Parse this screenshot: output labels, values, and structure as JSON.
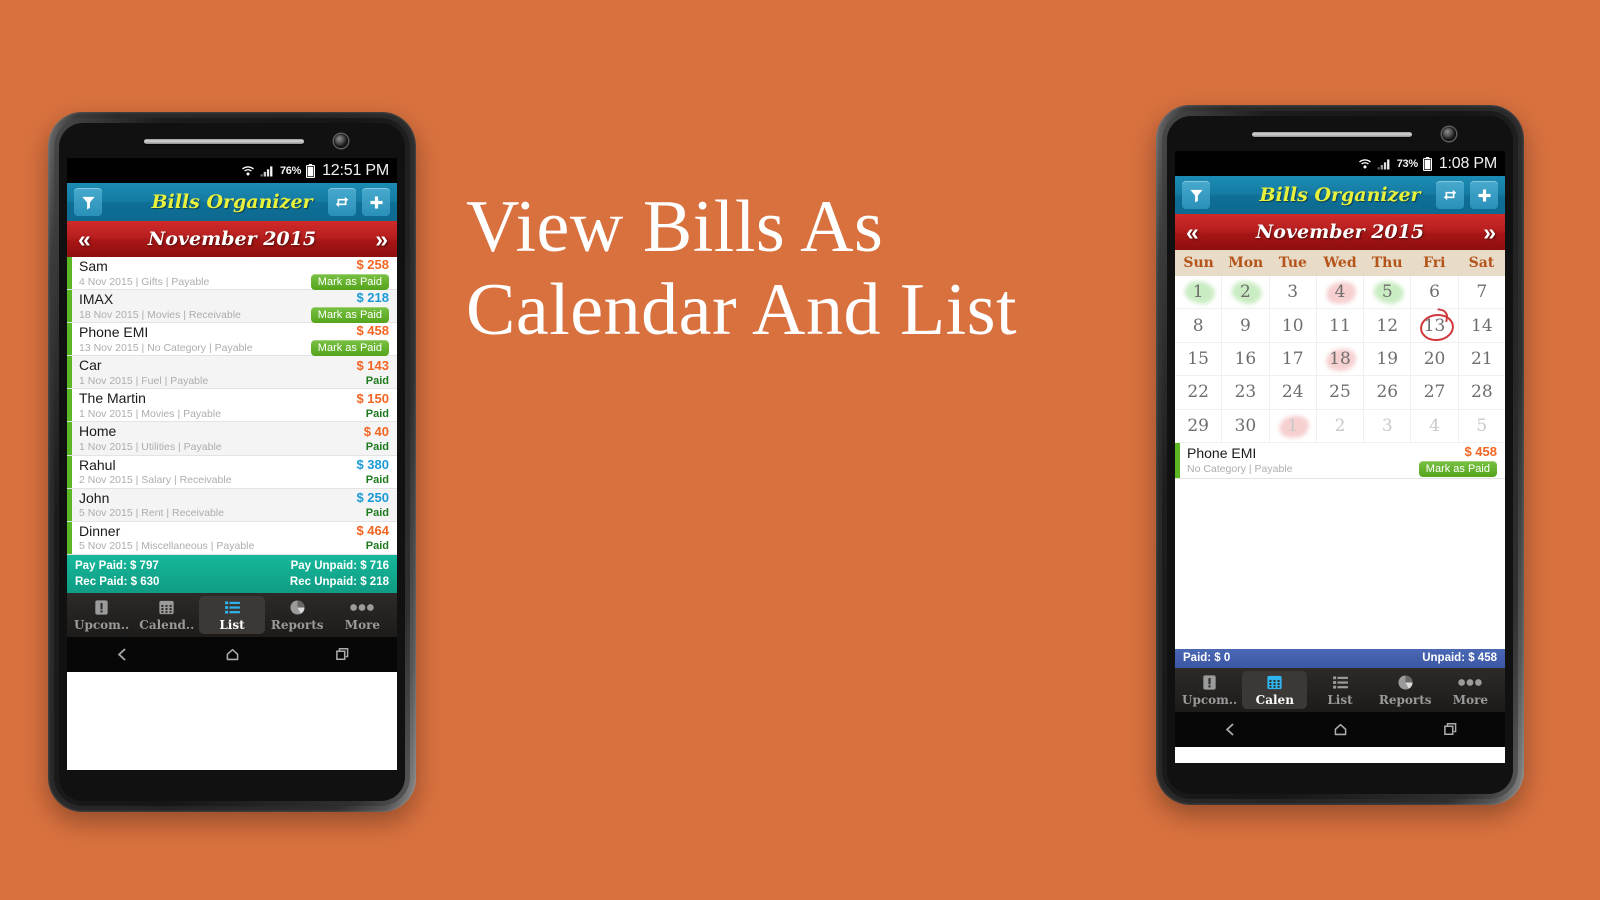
{
  "background_color": "#d9713f",
  "headline": {
    "line1": "View Bills As",
    "line2": "Calendar And List",
    "color": "#ffffff"
  },
  "colors": {
    "appbar": "#0f7ba3",
    "monthbar": "#b81f1f",
    "brand_yellow": "#e8f23c",
    "accent_green": "#5bb723",
    "payable_orange": "#f26522",
    "receivable_blue": "#1b9ad6",
    "summary_teal": "#10a88f",
    "summary_blue": "#4159a8",
    "calendar_header": "#e8dcc8",
    "calendar_dow_text": "#b5541a"
  },
  "phone_left": {
    "status_bar": {
      "wifi_icon": "wifi-icon",
      "signal_icon": "signal-icon",
      "battery_percent": "76%",
      "battery_icon": "battery-icon",
      "time": "12:51 PM"
    },
    "app_bar": {
      "filter_icon": "filter-icon",
      "title": "Bills Organizer",
      "repeat_icon": "repeat-icon",
      "add_icon": "plus-icon"
    },
    "month_bar": {
      "prev_icon": "chevron-double-left-icon",
      "title": "November 2015",
      "next_icon": "chevron-double-right-icon"
    },
    "bills": [
      {
        "name": "Sam",
        "meta": "4 Nov 2015 | Gifts | Payable",
        "amount": "$ 258",
        "kind": "payable",
        "status": "Mark as Paid",
        "paid": false
      },
      {
        "name": "IMAX",
        "meta": "18 Nov 2015 | Movies | Receivable",
        "amount": "$ 218",
        "kind": "receivable",
        "status": "Mark as Paid",
        "paid": false
      },
      {
        "name": "Phone EMI",
        "meta": "13 Nov 2015 | No Category | Payable",
        "amount": "$ 458",
        "kind": "payable",
        "status": "Mark as Paid",
        "paid": false
      },
      {
        "name": "Car",
        "meta": "1 Nov 2015 | Fuel | Payable",
        "amount": "$ 143",
        "kind": "payable",
        "status": "Paid",
        "paid": true
      },
      {
        "name": "The Martin",
        "meta": "1 Nov 2015 | Movies | Payable",
        "amount": "$ 150",
        "kind": "payable",
        "status": "Paid",
        "paid": true
      },
      {
        "name": "Home",
        "meta": "1 Nov 2015 | Utilities | Payable",
        "amount": "$ 40",
        "kind": "payable",
        "status": "Paid",
        "paid": true
      },
      {
        "name": "Rahul",
        "meta": "2 Nov 2015 | Salary | Receivable",
        "amount": "$ 380",
        "kind": "receivable",
        "status": "Paid",
        "paid": true
      },
      {
        "name": "John",
        "meta": "5 Nov 2015 | Rent | Receivable",
        "amount": "$ 250",
        "kind": "receivable",
        "status": "Paid",
        "paid": true
      },
      {
        "name": "Dinner",
        "meta": "5 Nov 2015 | Miscellaneous | Payable",
        "amount": "$ 464",
        "kind": "payable",
        "status": "Paid",
        "paid": true
      }
    ],
    "summary": {
      "pay_paid": "Pay Paid: $ 797",
      "pay_unpaid": "Pay Unpaid: $ 716",
      "rec_paid": "Rec Paid: $ 630",
      "rec_unpaid": "Rec Unpaid: $ 218"
    },
    "tabs": [
      {
        "label": "Upcom..",
        "icon": "exclamation-icon",
        "active": false
      },
      {
        "label": "Calend..",
        "icon": "calendar-icon",
        "active": false
      },
      {
        "label": "List",
        "icon": "list-icon",
        "active": true
      },
      {
        "label": "Reports",
        "icon": "pie-chart-icon",
        "active": false
      },
      {
        "label": "More",
        "icon": "more-dots-icon",
        "active": false
      }
    ],
    "nav_bar": {
      "back_icon": "back-icon",
      "home_icon": "home-icon",
      "recents_icon": "recents-icon"
    }
  },
  "phone_right": {
    "status_bar": {
      "wifi_icon": "wifi-icon",
      "signal_icon": "signal-icon",
      "battery_percent": "73%",
      "battery_icon": "battery-icon",
      "time": "1:08 PM"
    },
    "app_bar": {
      "filter_icon": "filter-icon",
      "title": "Bills Organizer",
      "repeat_icon": "repeat-icon",
      "add_icon": "plus-icon"
    },
    "month_bar": {
      "prev_icon": "chevron-double-left-icon",
      "title": "November 2015",
      "next_icon": "chevron-double-right-icon"
    },
    "calendar": {
      "day_names": [
        "Sun",
        "Mon",
        "Tue",
        "Wed",
        "Thu",
        "Fri",
        "Sat"
      ],
      "weeks": [
        [
          {
            "n": "1",
            "dim": false,
            "mark": "green"
          },
          {
            "n": "2",
            "dim": false,
            "mark": "green"
          },
          {
            "n": "3",
            "dim": false,
            "mark": ""
          },
          {
            "n": "4",
            "dim": false,
            "mark": "red"
          },
          {
            "n": "5",
            "dim": false,
            "mark": "green"
          },
          {
            "n": "6",
            "dim": false,
            "mark": ""
          },
          {
            "n": "7",
            "dim": false,
            "mark": ""
          }
        ],
        [
          {
            "n": "8",
            "dim": false,
            "mark": ""
          },
          {
            "n": "9",
            "dim": false,
            "mark": ""
          },
          {
            "n": "10",
            "dim": false,
            "mark": ""
          },
          {
            "n": "11",
            "dim": false,
            "mark": ""
          },
          {
            "n": "12",
            "dim": false,
            "mark": ""
          },
          {
            "n": "13",
            "dim": false,
            "mark": "",
            "today": true
          },
          {
            "n": "14",
            "dim": false,
            "mark": ""
          }
        ],
        [
          {
            "n": "15",
            "dim": false,
            "mark": ""
          },
          {
            "n": "16",
            "dim": false,
            "mark": ""
          },
          {
            "n": "17",
            "dim": false,
            "mark": ""
          },
          {
            "n": "18",
            "dim": false,
            "mark": "red"
          },
          {
            "n": "19",
            "dim": false,
            "mark": ""
          },
          {
            "n": "20",
            "dim": false,
            "mark": ""
          },
          {
            "n": "21",
            "dim": false,
            "mark": ""
          }
        ],
        [
          {
            "n": "22",
            "dim": false,
            "mark": ""
          },
          {
            "n": "23",
            "dim": false,
            "mark": ""
          },
          {
            "n": "24",
            "dim": false,
            "mark": ""
          },
          {
            "n": "25",
            "dim": false,
            "mark": ""
          },
          {
            "n": "26",
            "dim": false,
            "mark": ""
          },
          {
            "n": "27",
            "dim": false,
            "mark": ""
          },
          {
            "n": "28",
            "dim": false,
            "mark": ""
          }
        ],
        [
          {
            "n": "29",
            "dim": false,
            "mark": ""
          },
          {
            "n": "30",
            "dim": false,
            "mark": ""
          },
          {
            "n": "1",
            "dim": true,
            "mark": "red"
          },
          {
            "n": "2",
            "dim": true,
            "mark": ""
          },
          {
            "n": "3",
            "dim": true,
            "mark": ""
          },
          {
            "n": "4",
            "dim": true,
            "mark": ""
          },
          {
            "n": "5",
            "dim": true,
            "mark": ""
          }
        ]
      ]
    },
    "bills": [
      {
        "name": "Phone EMI",
        "meta": "No Category | Payable",
        "amount": "$ 458",
        "kind": "payable",
        "status": "Mark as Paid",
        "paid": false
      }
    ],
    "summary": {
      "paid": "Paid: $ 0",
      "unpaid": "Unpaid: $ 458"
    },
    "tabs": [
      {
        "label": "Upcom..",
        "icon": "exclamation-icon",
        "active": false
      },
      {
        "label": "Calen",
        "icon": "calendar-icon",
        "active": true
      },
      {
        "label": "List",
        "icon": "list-icon",
        "active": false
      },
      {
        "label": "Reports",
        "icon": "pie-chart-icon",
        "active": false
      },
      {
        "label": "More",
        "icon": "more-dots-icon",
        "active": false
      }
    ],
    "nav_bar": {
      "back_icon": "back-icon",
      "home_icon": "home-icon",
      "recents_icon": "recents-icon"
    }
  }
}
